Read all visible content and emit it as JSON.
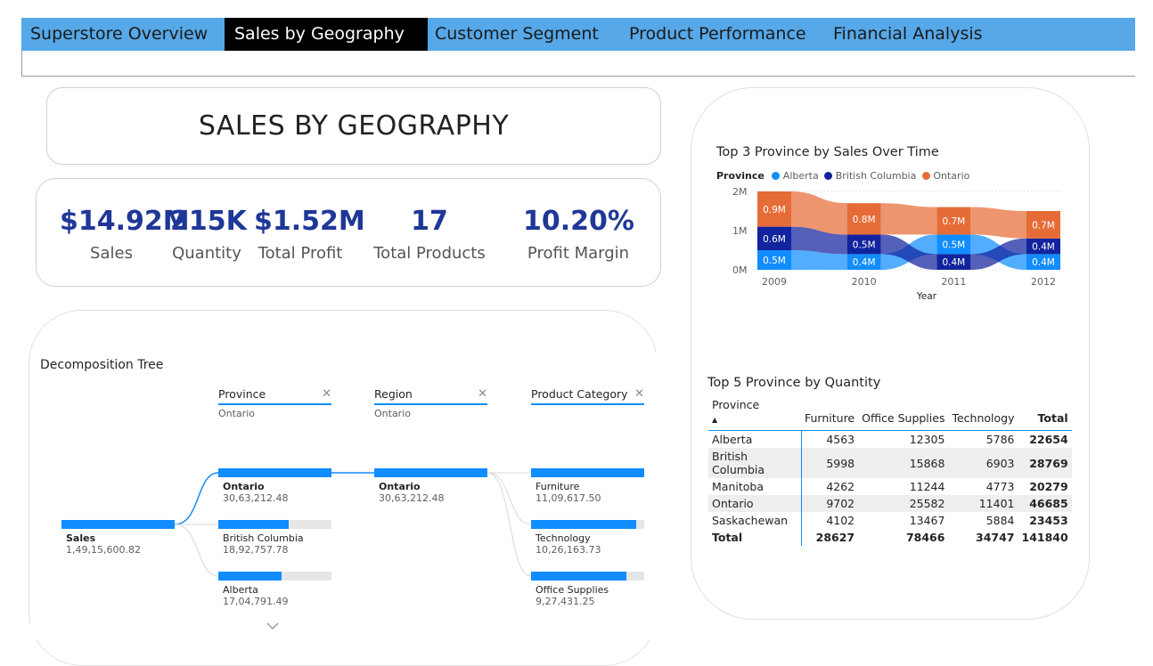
{
  "nav": {
    "tabs": [
      {
        "label": "Superstore Overview",
        "active": false
      },
      {
        "label": "Sales by Geography",
        "active": true
      },
      {
        "label": "Customer Segment",
        "active": false
      },
      {
        "label": "Product Performance",
        "active": false
      },
      {
        "label": "Financial Analysis",
        "active": false
      }
    ]
  },
  "page_title": "SALES BY GEOGRAPHY",
  "kpis": [
    {
      "value": "$14.92M",
      "label": "Sales"
    },
    {
      "value": "215K",
      "label": "Quantity"
    },
    {
      "value": "$1.52M",
      "label": "Total Profit"
    },
    {
      "value": "17",
      "label": "Total Products"
    },
    {
      "value": "10.20%",
      "label": "Profit Margin"
    }
  ],
  "decomposition": {
    "title": "Decomposition Tree",
    "levels": [
      {
        "header": "Province",
        "filter": "Ontario"
      },
      {
        "header": "Region",
        "filter": "Ontario"
      },
      {
        "header": "Product Category",
        "filter": ""
      }
    ],
    "root": {
      "name": "Sales",
      "value": "1,49,15,600.82",
      "fraction": 1.0
    },
    "province_nodes": [
      {
        "name": "Ontario",
        "value": "30,63,212.48",
        "fraction": 1.0,
        "selected": true
      },
      {
        "name": "British Columbia",
        "value": "18,92,757.78",
        "fraction": 0.62,
        "selected": false
      },
      {
        "name": "Alberta",
        "value": "17,04,791.49",
        "fraction": 0.56,
        "selected": false
      }
    ],
    "region_nodes": [
      {
        "name": "Ontario",
        "value": "30,63,212.48",
        "fraction": 1.0,
        "selected": true
      }
    ],
    "category_nodes": [
      {
        "name": "Furniture",
        "value": "11,09,617.50",
        "fraction": 1.0
      },
      {
        "name": "Technology",
        "value": "10,26,163.73",
        "fraction": 0.93
      },
      {
        "name": "Office Supplies",
        "value": "9,27,431.25",
        "fraction": 0.84
      }
    ],
    "expand_icon": "chevron-down-icon"
  },
  "chart_data": {
    "type": "area",
    "title": "Top 3 Province by Sales Over Time",
    "legend_title": "Province",
    "legend_position": "top-left",
    "xlabel": "Year",
    "ylabel": "",
    "categories": [
      "2009",
      "2010",
      "2011",
      "2012"
    ],
    "y_ticks": [
      "0M",
      "1M",
      "2M"
    ],
    "ylim": [
      0,
      2
    ],
    "stacked": true,
    "series": [
      {
        "name": "Alberta",
        "color": "#118dff",
        "values": [
          0.5,
          0.4,
          0.5,
          0.4
        ],
        "labels": [
          "0.5M",
          "0.4M",
          "0.5M",
          "0.4M"
        ],
        "rank": [
          1,
          1,
          2,
          1
        ]
      },
      {
        "name": "British Columbia",
        "color": "#12239e",
        "values": [
          0.6,
          0.5,
          0.4,
          0.4
        ],
        "labels": [
          "0.6M",
          "0.5M",
          "0.4M",
          "0.4M"
        ],
        "rank": [
          2,
          2,
          1,
          2
        ]
      },
      {
        "name": "Ontario",
        "color": "#e66c37",
        "values": [
          0.9,
          0.8,
          0.7,
          0.7
        ],
        "labels": [
          "0.9M",
          "0.8M",
          "0.7M",
          "0.7M"
        ],
        "rank": [
          3,
          3,
          3,
          3
        ]
      }
    ]
  },
  "table": {
    "title": "Top 5 Province by Quantity",
    "columns": [
      "Province",
      "Furniture",
      "Office Supplies",
      "Technology",
      "Total"
    ],
    "rows": [
      [
        "Alberta",
        "4563",
        "12305",
        "5786",
        "22654"
      ],
      [
        "British Columbia",
        "5998",
        "15868",
        "6903",
        "28769"
      ],
      [
        "Manitoba",
        "4262",
        "11244",
        "4773",
        "20279"
      ],
      [
        "Ontario",
        "9702",
        "25582",
        "11401",
        "46685"
      ],
      [
        "Saskachewan",
        "4102",
        "13467",
        "5884",
        "23453"
      ]
    ],
    "total_row": [
      "Total",
      "28627",
      "78466",
      "34747",
      "141840"
    ],
    "sort_icon": "sort-ascending-icon"
  }
}
